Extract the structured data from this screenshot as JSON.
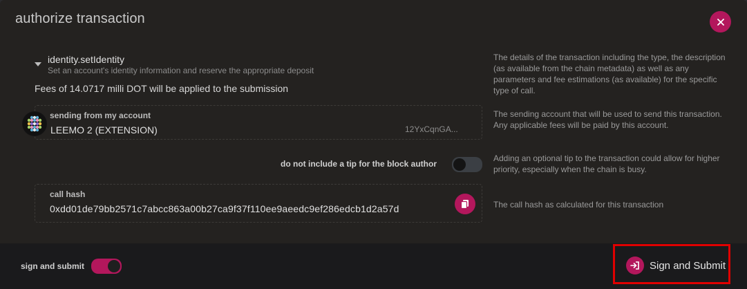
{
  "modal": {
    "title": "authorize transaction",
    "close_icon": "close-icon"
  },
  "call": {
    "method": "identity.setIdentity",
    "description": "Set an account's identity information and reserve the appropriate deposit",
    "fees": "Fees of 14.0717 milli DOT will be applied to the submission"
  },
  "account": {
    "label": "sending from my account",
    "name": "LEEMO 2 (EXTENSION)",
    "address": "12YxCqnGA..."
  },
  "tip": {
    "label": "do not include a tip for the block author",
    "enabled": false
  },
  "hash": {
    "label": "call hash",
    "value": "0xdd01de79bb2571c7abcc863a00b27ca9f37f110ee9aeedc9ef286edcb1d2a57d",
    "copy_icon": "copy-icon"
  },
  "help": {
    "details": "The details of the transaction including the type, the description (as available from the chain metadata) as well as any parameters and fee estimations (as available) for the specific type of call.",
    "account": "The sending account that will be used to send this transaction. Any applicable fees will be paid by this account.",
    "tip": "Adding an optional tip to the transaction could allow for higher priority, especially when the chain is busy.",
    "hash": "The call hash as calculated for this transaction"
  },
  "footer": {
    "sign_label": "sign and submit",
    "sign_enabled": true,
    "submit_label": "Sign and Submit",
    "submit_icon": "sign-in-icon"
  },
  "colors": {
    "accent": "#b3175c",
    "modal_bg": "#242220",
    "footer_bg": "#1a1a1c",
    "highlight": "#e00000"
  }
}
